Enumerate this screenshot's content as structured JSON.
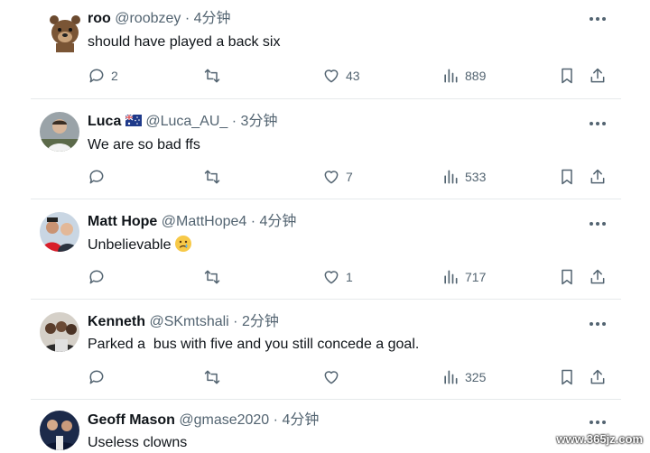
{
  "tweets": [
    {
      "name": "roo",
      "handle": "@roobzey",
      "time": "4分钟",
      "text": "should have played a back six",
      "replies": "2",
      "retweets": "",
      "likes": "43",
      "views": "889",
      "avatar": "brown-bear-avatar"
    },
    {
      "name": "Luca",
      "handle": "@Luca_AU_",
      "time": "3分钟",
      "text": "We are so bad ffs",
      "replies": "",
      "retweets": "",
      "likes": "7",
      "views": "533",
      "avatar": "man-photo-avatar",
      "flag": "australia-flag"
    },
    {
      "name": "Matt Hope",
      "handle": "@MattHope4",
      "time": "4分钟",
      "text": "Unbelievable",
      "emoji": "crying-face-emoji",
      "replies": "",
      "retweets": "",
      "likes": "1",
      "views": "717",
      "avatar": "two-men-photo-avatar"
    },
    {
      "name": "Kenneth",
      "handle": "@SKmtshali",
      "time": "2分钟",
      "text": "Parked a  bus with five and you still concede a goal.",
      "replies": "",
      "retweets": "",
      "likes": "",
      "views": "325",
      "avatar": "group-photo-avatar"
    },
    {
      "name": "Geoff Mason",
      "handle": "@gmase2020",
      "time": "4分钟",
      "text": "Useless clowns",
      "avatar": "dark-photo-avatar"
    }
  ],
  "separator": "·",
  "watermark": "www.365jz.com",
  "colors": {
    "text": "#0f1419",
    "muted": "#536471",
    "divider": "#e6e9eb"
  }
}
